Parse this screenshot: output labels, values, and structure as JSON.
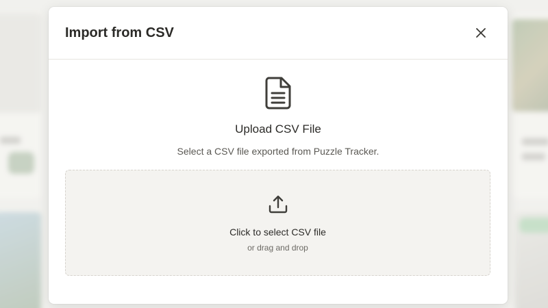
{
  "modal": {
    "title": "Import from CSV",
    "close_icon": "close-icon",
    "file_icon": "file-text-icon",
    "upload_title": "Upload CSV File",
    "upload_subtitle": "Select a CSV file exported from Puzzle Tracker.",
    "dropzone": {
      "icon": "upload-icon",
      "primary": "Click to select CSV file",
      "secondary": "or drag and drop"
    }
  },
  "colors": {
    "modal_bg": "#ffffff",
    "text_primary": "#2b2a27",
    "dropzone_bg": "#f4f3f0",
    "dropzone_border": "#d6d3cd",
    "accent_green": "#7f9a79"
  }
}
